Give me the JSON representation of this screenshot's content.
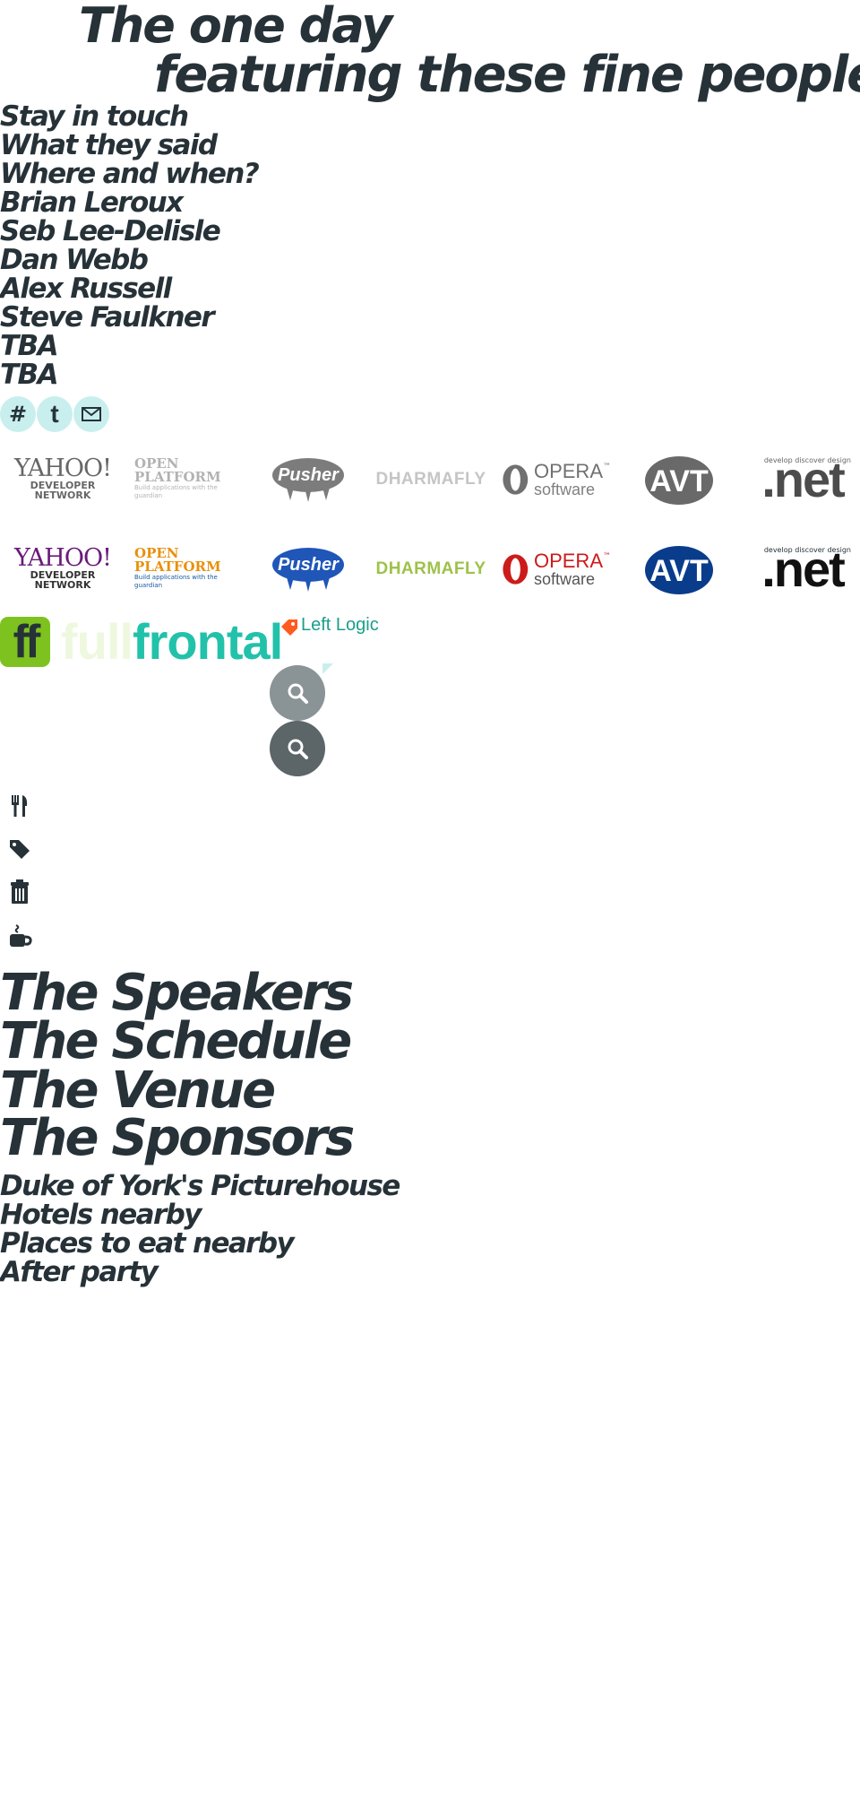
{
  "hero": {
    "line1": "The one day",
    "line2": "featuring these fine people"
  },
  "nav": {
    "items": [
      "Stay in touch",
      "What they said",
      "Where and when?",
      "Brian Leroux",
      "Seb Lee-Delisle",
      "Dan Webb",
      "Alex Russell",
      "Steve Faulkner",
      "TBA",
      "TBA"
    ]
  },
  "social": {
    "hash_glyph": "#",
    "twitter_glyph": "t",
    "icons": [
      "hashtag-icon",
      "twitter-icon",
      "mail-icon"
    ]
  },
  "sponsor_logos": {
    "yahoo_word": "YAHOO!",
    "yahoo_sub1": "DEVELOPER",
    "yahoo_sub2": "NETWORK",
    "open_word1": "OPEN",
    "open_word2": "PLATFORM",
    "open_tagline": "Build applications with the guardian",
    "pusher": "Pusher",
    "dharmafly": "DHARMAFLY",
    "opera_word": "OPERA",
    "opera_tm": "™",
    "opera_sub": "software",
    "avt": "AVT",
    "net_word": ".net",
    "net_tagline": "develop discover design",
    "colors": {
      "yahoo": "#6a1b7a",
      "open": "#e8900c",
      "pusher": "#1f56b8",
      "dharmafly": "#9ec24a",
      "opera": "#cc1b1b",
      "avt": "#0a3c8c",
      "net_dot": "#7ec21f"
    }
  },
  "brand": {
    "ff_badge": "ff",
    "full": "full",
    "frontal": "frontal",
    "leftlogic": "Left Logic",
    "colors": {
      "ff_green": "#7ec21f",
      "frontal_teal": "#22c1aa",
      "full_faded": "#eef8df",
      "leftlogic_orange": "#ff5a1f",
      "leftlogic_teal": "#1a9f8a"
    }
  },
  "search": {
    "icons": [
      "search-icon",
      "search-icon"
    ],
    "colors": {
      "light": "#8a9396",
      "dark": "#5c6568"
    }
  },
  "amenity_icons": [
    "cutlery-icon",
    "tag-icon",
    "bin-icon",
    "coffee-cup-icon"
  ],
  "sections": {
    "headings": [
      "The Speakers",
      "The Schedule",
      "The Venue",
      "The Sponsors"
    ]
  },
  "venue": {
    "items": [
      "Duke of York's Picturehouse",
      "Hotels nearby",
      "Places to eat nearby",
      "After party"
    ]
  }
}
